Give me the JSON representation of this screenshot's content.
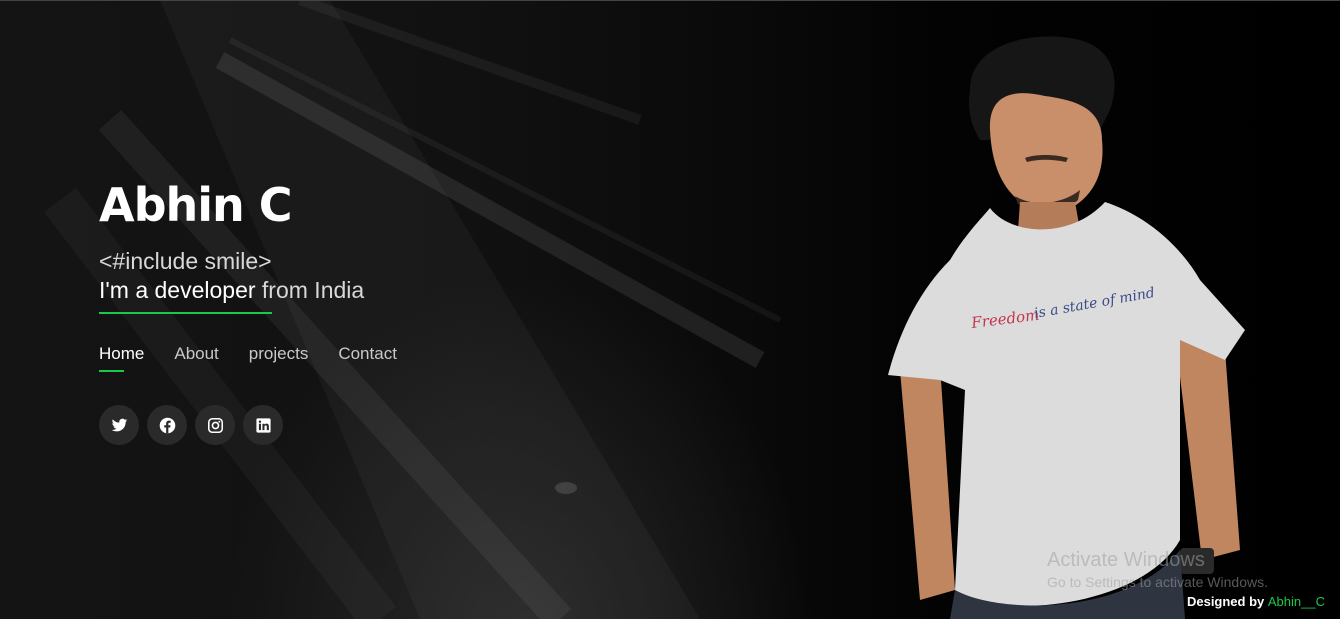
{
  "hero": {
    "name": "Abhin C",
    "tagline_line1": "<#include smile>",
    "tagline_highlight": "I'm a developer",
    "tagline_rest": " from India"
  },
  "nav": {
    "items": [
      {
        "label": "Home",
        "active": true
      },
      {
        "label": "About",
        "active": false
      },
      {
        "label": "projects",
        "active": false
      },
      {
        "label": "Contact",
        "active": false
      }
    ]
  },
  "social": {
    "icons": [
      "twitter-icon",
      "facebook-icon",
      "instagram-icon",
      "linkedin-icon"
    ]
  },
  "photo": {
    "shirt_text_1": "Freedom",
    "shirt_text_2": "is a state of mind"
  },
  "watermark": {
    "title": "Activate Windows",
    "subtitle": "Go to Settings to activate Windows."
  },
  "footer": {
    "designed_by": "Designed by",
    "author": "Abhin__C"
  },
  "colors": {
    "accent": "#18c94a",
    "background": "#000000",
    "icon_bg": "#2a2a2a"
  }
}
